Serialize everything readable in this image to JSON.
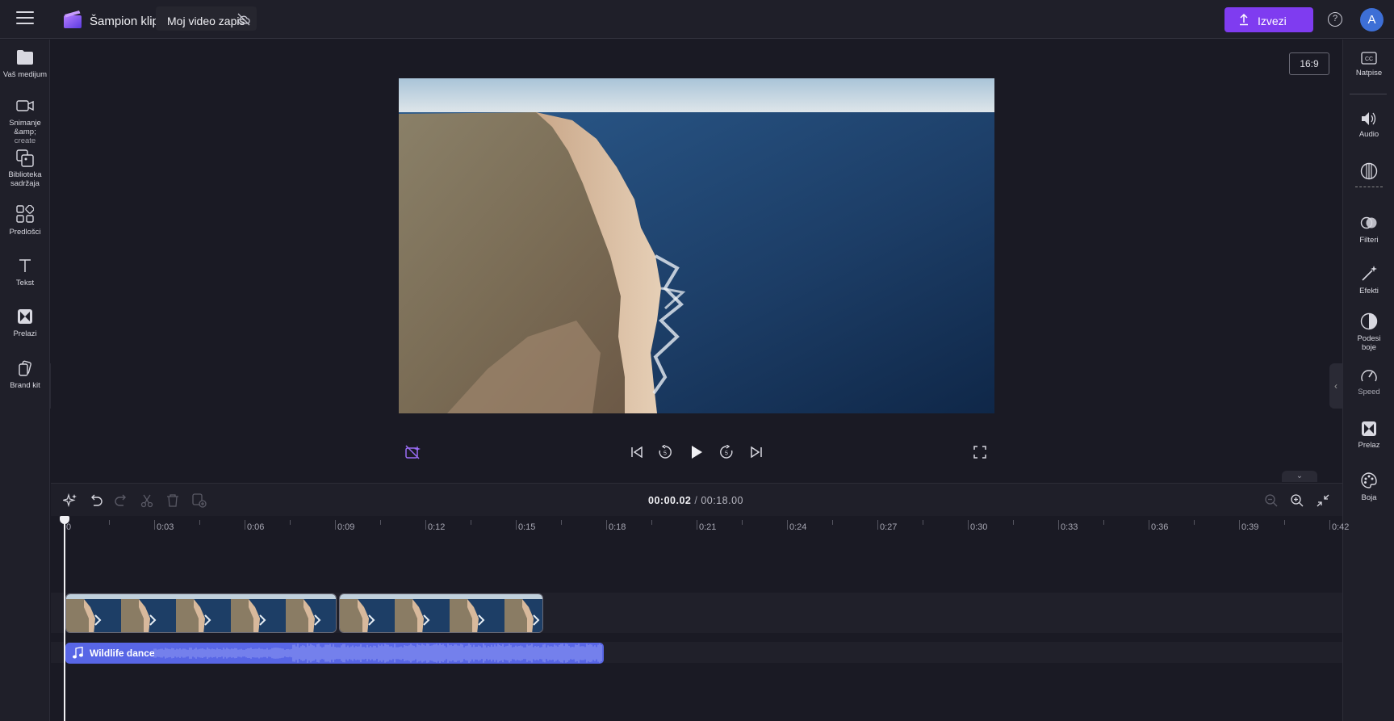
{
  "header": {
    "app_name": "Šampion klipa",
    "project_name": "Moj video zapis",
    "export_label": "Izvezi",
    "help_label": "?",
    "avatar_initial": "A"
  },
  "left_nav": [
    {
      "label": "Vaš medijum",
      "icon": "folder-icon"
    },
    {
      "label": "Snimanje &amp;",
      "sub": "create",
      "icon": "video-camera-icon"
    },
    {
      "label": "Biblioteka sadržaja",
      "icon": "content-library-icon"
    },
    {
      "label": "Predlošci",
      "icon": "templates-icon"
    },
    {
      "label": "Tekst",
      "icon": "text-icon"
    },
    {
      "label": "Prelazi",
      "icon": "transitions-icon"
    },
    {
      "label": "Brand kit",
      "icon": "brand-kit-icon"
    }
  ],
  "right_nav": [
    {
      "label": "Natpise",
      "icon": "captions-icon"
    },
    {
      "label": "Audio",
      "icon": "audio-icon"
    },
    {
      "label": "",
      "icon": "fade-icon"
    },
    {
      "label": "Filteri",
      "icon": "filters-icon"
    },
    {
      "label": "Efekti",
      "icon": "effects-icon"
    },
    {
      "label": "Podesi boje",
      "icon": "color-adjust-icon"
    },
    {
      "label": "Speed",
      "icon": "speed-icon"
    },
    {
      "label": "Prelaz",
      "icon": "transition-icon"
    },
    {
      "label": "Boja",
      "icon": "palette-icon"
    }
  ],
  "preview": {
    "aspect_ratio": "16:9"
  },
  "timeline": {
    "current_time": "00:00.02",
    "separator": "/",
    "total_time": "00:18.00",
    "ruler_labels": [
      "0",
      "0:03",
      "0:06",
      "0:09",
      "0:12",
      "0:15",
      "0:18",
      "0:21",
      "0:24",
      "0:27",
      "0:30",
      "0:33",
      "0:36",
      "0:39",
      "0:42"
    ],
    "audio_clip_name": "Wildlife dance"
  },
  "colors": {
    "accent": "#7f3cf0",
    "audio_clip": "#5866e6",
    "background": "#1a1a24",
    "panel": "#1f1f29"
  }
}
